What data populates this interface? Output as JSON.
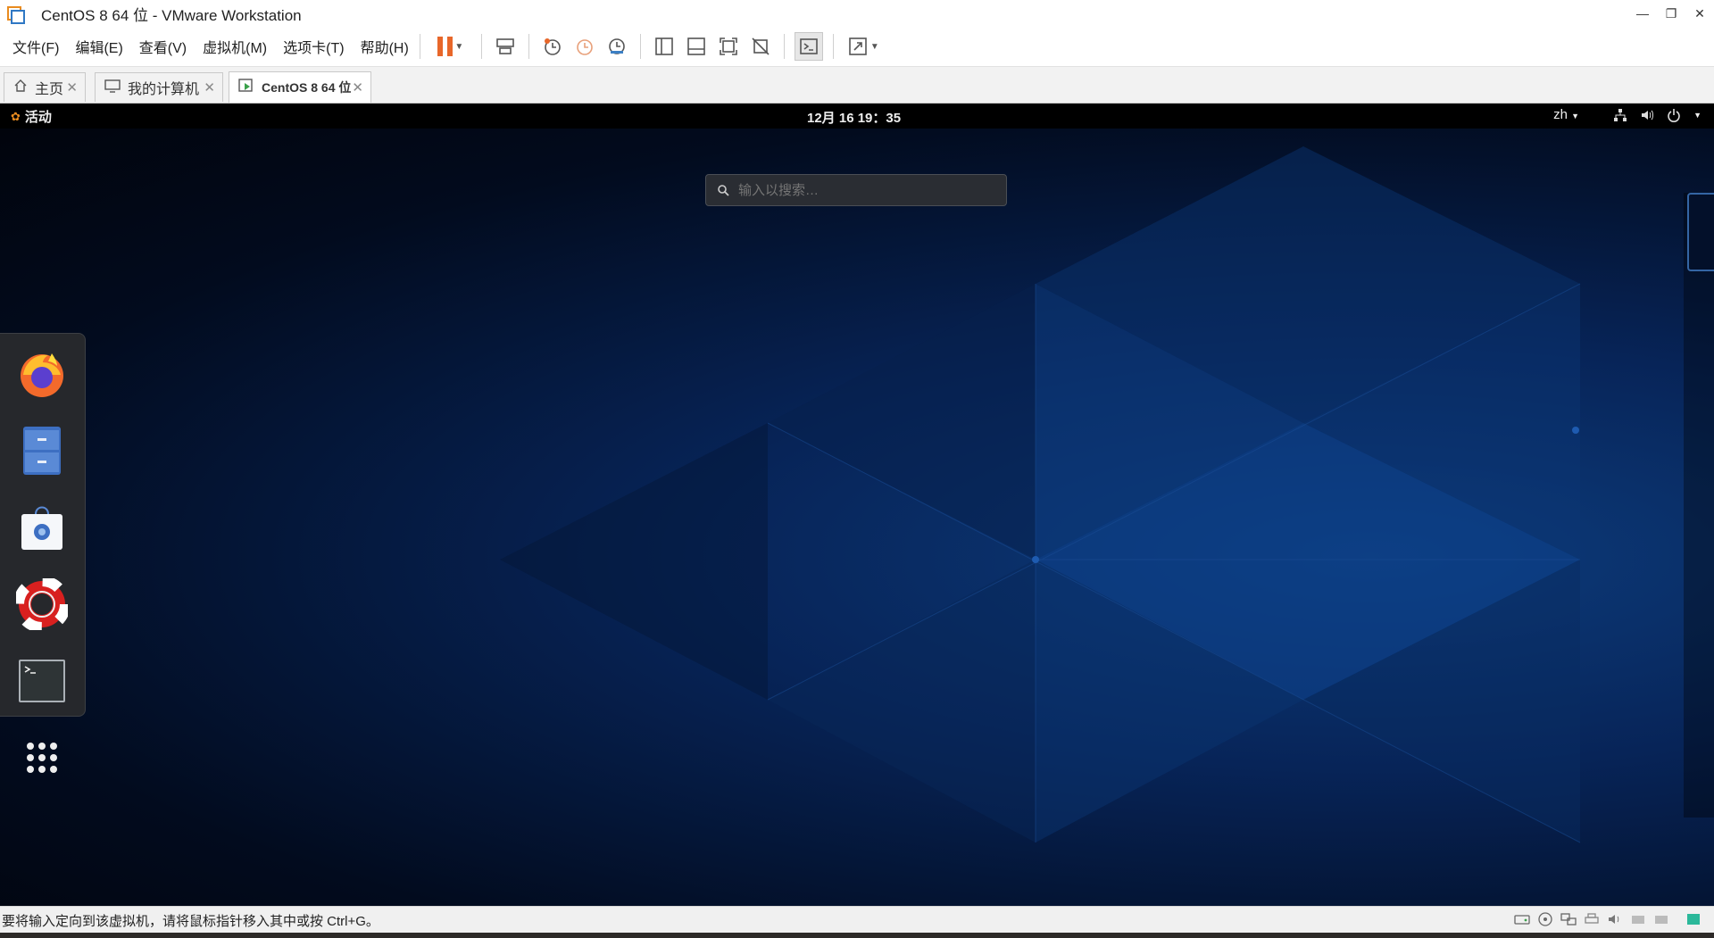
{
  "window": {
    "title": "CentOS 8 64 位 - VMware Workstation"
  },
  "menubar": {
    "items": [
      "文件(F)",
      "编辑(E)",
      "查看(V)",
      "虚拟机(M)",
      "选项卡(T)",
      "帮助(H)"
    ]
  },
  "toolbar": {
    "icons": [
      "pause-icon",
      "send-ctrl-alt-del-icon",
      "snapshot-icon",
      "revert-snapshot-icon",
      "snapshot-manager-icon",
      "library-view-icon",
      "thumbnail-view-icon",
      "fullscreen-icon",
      "unity-icon",
      "console-view-icon",
      "stretch-icon"
    ]
  },
  "tabs": [
    {
      "label": "主页",
      "icon": "home-icon"
    },
    {
      "label": "我的计算机",
      "icon": "computer-icon"
    },
    {
      "label": "CentOS 8 64 位",
      "icon": "vm-running-icon",
      "active": true
    }
  ],
  "guest": {
    "activities_label": "活动",
    "clock": "12月 16  19：35",
    "input_method": "zh",
    "search_placeholder": "输入以搜索…",
    "dash_apps": [
      "firefox-icon",
      "files-icon",
      "software-icon",
      "help-icon",
      "terminal-icon",
      "show-apps-icon"
    ]
  },
  "statusbar": {
    "text": "要将输入定向到该虚拟机，请将鼠标指针移入其中或按 Ctrl+G。"
  },
  "colors": {
    "accent": "#e8672a",
    "gnome_blue": "#4a90d9"
  }
}
